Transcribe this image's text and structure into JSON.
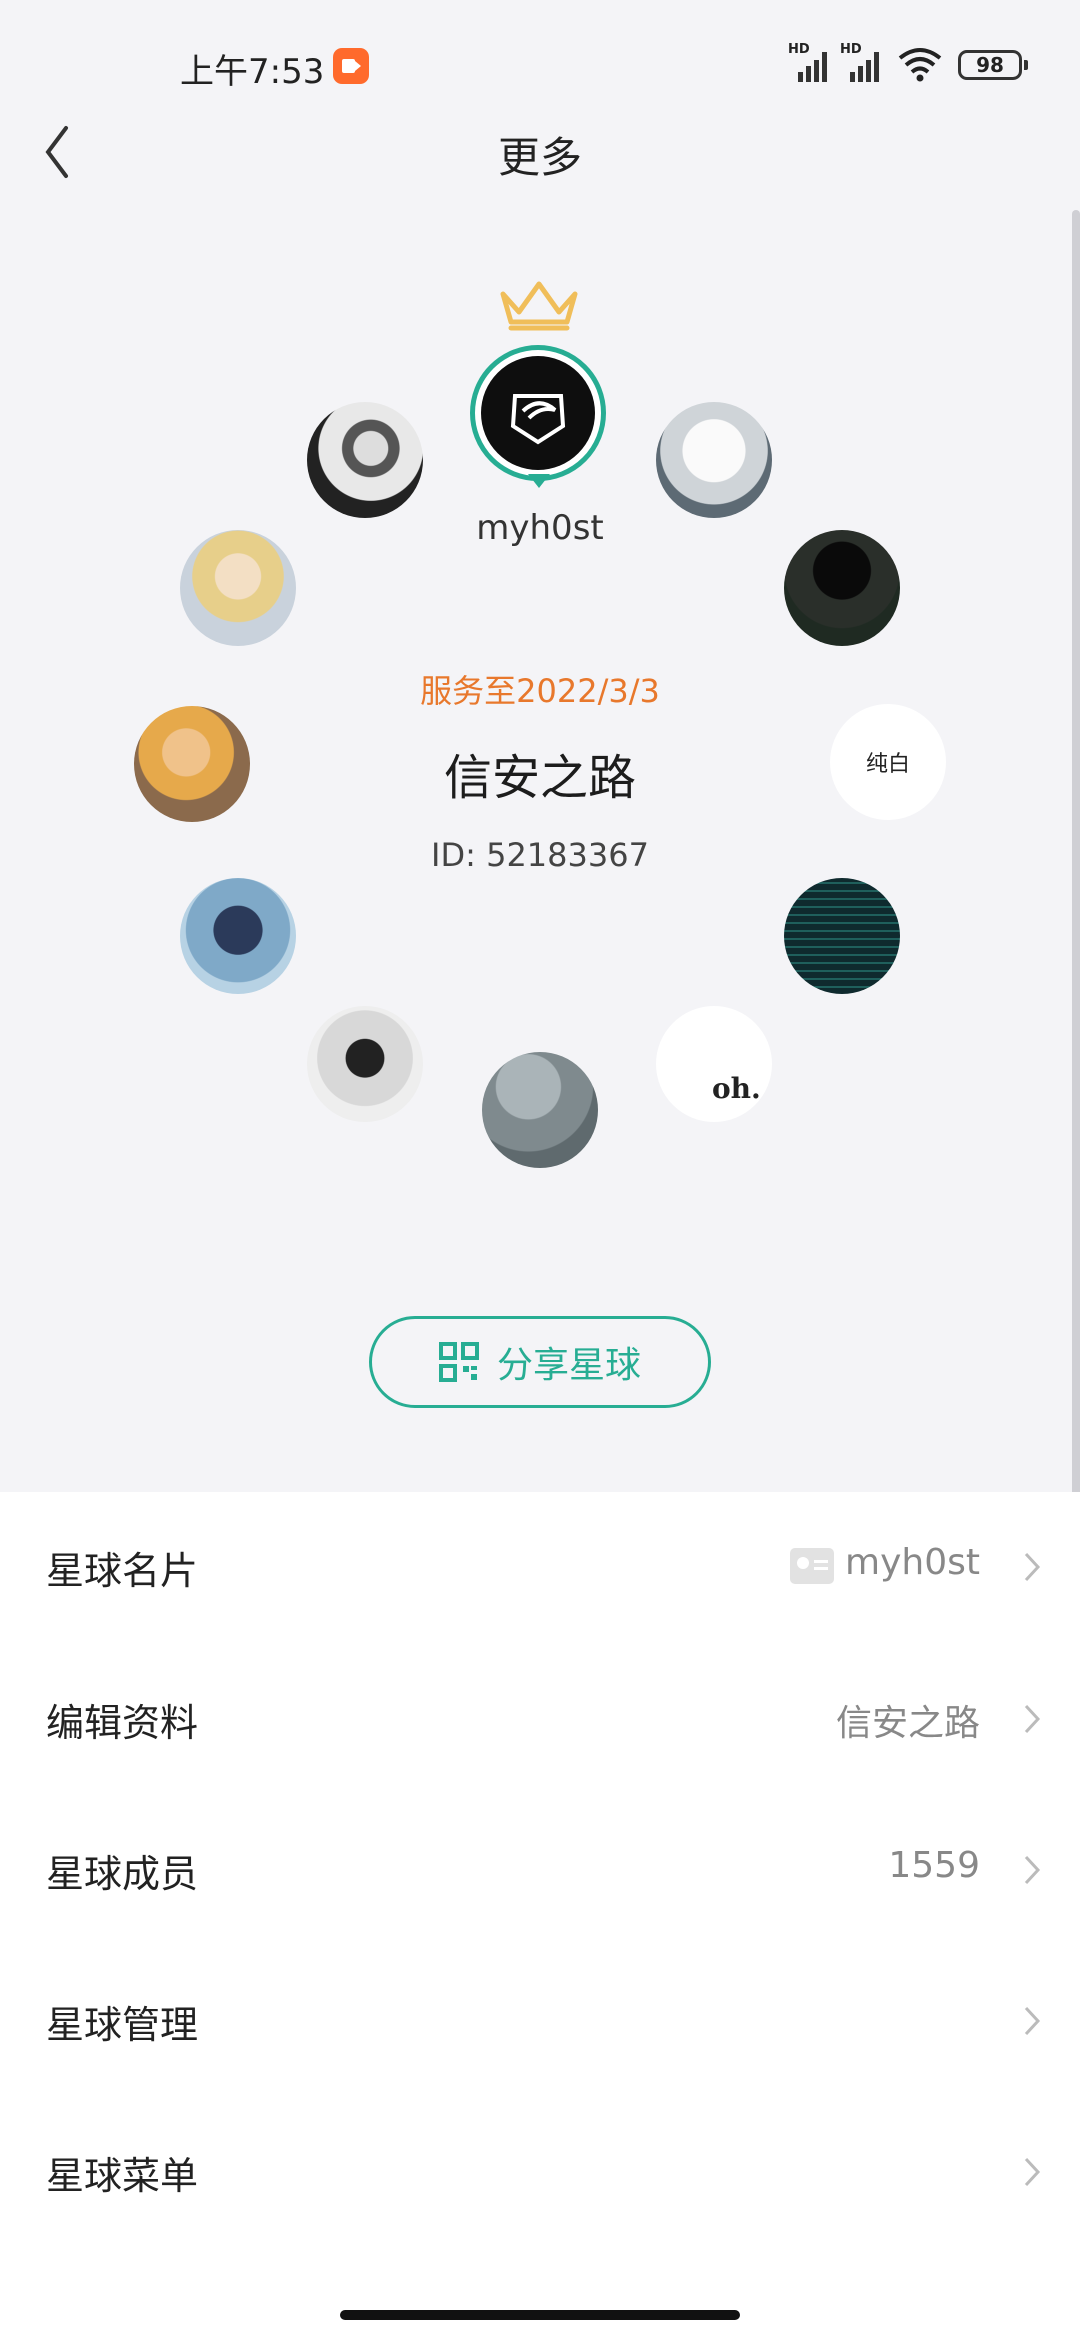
{
  "status_bar": {
    "time": "上午7:53",
    "hd1": "HD",
    "hd2": "HD",
    "battery": "98",
    "accent_color": "#ff6a2c"
  },
  "header": {
    "title": "更多",
    "back_icon": "chevron-left-icon"
  },
  "planet": {
    "owner_name": "myh0st",
    "service_date": "服务至2022/3/3",
    "name": "信安之路",
    "id_text": "ID: 52183367",
    "member_text_avatar": "纯白",
    "member_logo_text": "oh."
  },
  "share": {
    "label": "分享星球",
    "icon": "qr-code-icon",
    "color": "#27ad93"
  },
  "menu": {
    "items": [
      {
        "label": "星球名片",
        "value": "myh0st"
      },
      {
        "label": "编辑资料",
        "value": "信安之路"
      },
      {
        "label": "星球成员",
        "value": "1559"
      },
      {
        "label": "星球管理",
        "value": ""
      },
      {
        "label": "星球菜单",
        "value": ""
      }
    ]
  },
  "colors": {
    "brand": "#27ad93",
    "date": "#e8782c"
  }
}
